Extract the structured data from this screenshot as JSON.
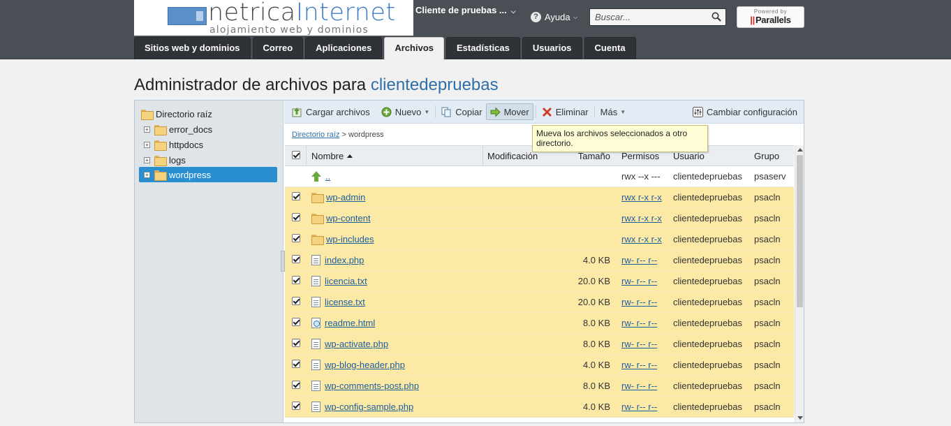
{
  "header": {
    "logo": {
      "main_a": "netrica",
      "main_b": "Internet",
      "sub": "alojamiento web y dominios"
    },
    "client_menu": "Cliente de pruebas ...",
    "help": "Ayuda",
    "search_placeholder": "Buscar...",
    "powered_by": "Powered by",
    "powered_brand": "Parallels"
  },
  "tabs": [
    {
      "label": "Sitios web y dominios",
      "active": false
    },
    {
      "label": "Correo",
      "active": false
    },
    {
      "label": "Aplicaciones",
      "active": false
    },
    {
      "label": "Archivos",
      "active": true
    },
    {
      "label": "Estadísticas",
      "active": false
    },
    {
      "label": "Usuarios",
      "active": false
    },
    {
      "label": "Cuenta",
      "active": false
    }
  ],
  "page": {
    "title_prefix": "Administrador de archivos para",
    "client": "clientedepruebas"
  },
  "tree": {
    "root": "Directorio raíz",
    "items": [
      {
        "label": "error_docs",
        "selected": false
      },
      {
        "label": "httpdocs",
        "selected": false
      },
      {
        "label": "logs",
        "selected": false
      },
      {
        "label": "wordpress",
        "selected": true
      }
    ]
  },
  "toolbar": {
    "upload": "Cargar archivos",
    "new": "Nuevo",
    "copy": "Copiar",
    "move": "Mover",
    "delete": "Eliminar",
    "more": "Más",
    "settings": "Cambiar configuración"
  },
  "breadcrumb": {
    "root": "Directorio raíz",
    "sep": ">",
    "current": "wordpress"
  },
  "tooltip": "Mueva los archivos seleccionados a otro directorio.",
  "columns": {
    "name": "Nombre",
    "modified": "Modificación",
    "size": "Tamaño",
    "perms": "Permisos",
    "user": "Usuario",
    "group": "Grupo"
  },
  "rows": [
    {
      "type": "parent",
      "name": "..",
      "size": "",
      "perms": "rwx --x ---",
      "user": "clientedepruebas",
      "group": "psaserv",
      "checked": false
    },
    {
      "type": "folder",
      "name": "wp-admin",
      "size": "",
      "perms": "rwx r-x r-x",
      "user": "clientedepruebas",
      "group": "psacln",
      "checked": true
    },
    {
      "type": "folder",
      "name": "wp-content",
      "size": "",
      "perms": "rwx r-x r-x",
      "user": "clientedepruebas",
      "group": "psacln",
      "checked": true
    },
    {
      "type": "folder",
      "name": "wp-includes",
      "size": "",
      "perms": "rwx r-x r-x",
      "user": "clientedepruebas",
      "group": "psacln",
      "checked": true
    },
    {
      "type": "file",
      "name": "index.php",
      "size": "4.0 KB",
      "perms": "rw- r-- r--",
      "user": "clientedepruebas",
      "group": "psacln",
      "checked": true
    },
    {
      "type": "file",
      "name": "licencia.txt",
      "size": "20.0 KB",
      "perms": "rw- r-- r--",
      "user": "clientedepruebas",
      "group": "psacln",
      "checked": true
    },
    {
      "type": "file",
      "name": "license.txt",
      "size": "20.0 KB",
      "perms": "rw- r-- r--",
      "user": "clientedepruebas",
      "group": "psacln",
      "checked": true
    },
    {
      "type": "html",
      "name": "readme.html",
      "size": "8.0 KB",
      "perms": "rw- r-- r--",
      "user": "clientedepruebas",
      "group": "psacln",
      "checked": true
    },
    {
      "type": "file",
      "name": "wp-activate.php",
      "size": "8.0 KB",
      "perms": "rw- r-- r--",
      "user": "clientedepruebas",
      "group": "psacln",
      "checked": true
    },
    {
      "type": "file",
      "name": "wp-blog-header.php",
      "size": "4.0 KB",
      "perms": "rw- r-- r--",
      "user": "clientedepruebas",
      "group": "psacln",
      "checked": true
    },
    {
      "type": "file",
      "name": "wp-comments-post.php",
      "size": "8.0 KB",
      "perms": "rw- r-- r--",
      "user": "clientedepruebas",
      "group": "psacln",
      "checked": true
    },
    {
      "type": "file",
      "name": "wp-config-sample.php",
      "size": "4.0 KB",
      "perms": "rw- r-- r--",
      "user": "clientedepruebas",
      "group": "psacln",
      "checked": true
    }
  ]
}
